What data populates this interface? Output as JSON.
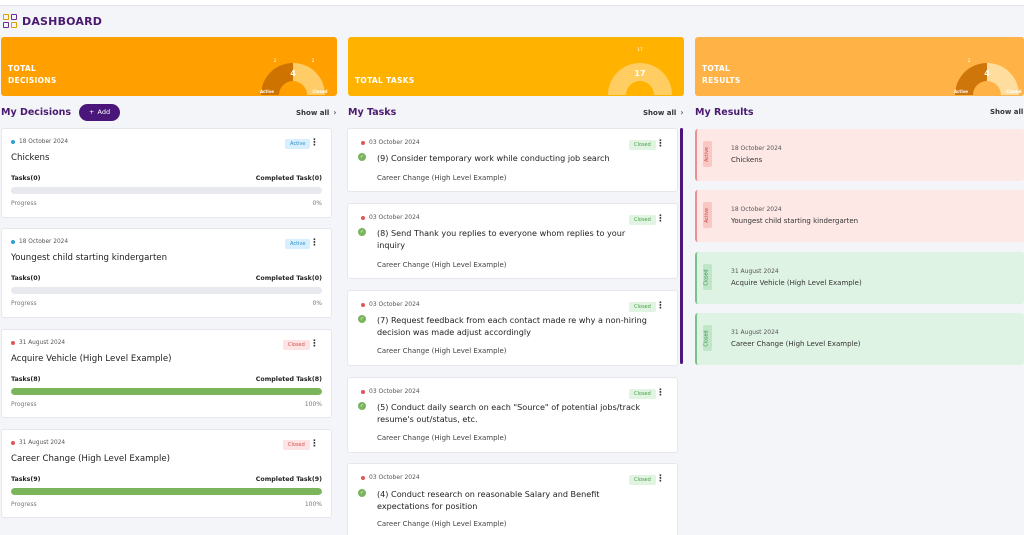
{
  "header": {
    "title": "DASHBOARD"
  },
  "stats": [
    {
      "label_line1": "TOTAL",
      "label_line2": "DECISIONS",
      "total": "4",
      "active": "2",
      "closed": "2",
      "active_label": "Active",
      "closed_label": "Closed",
      "active_fraction": 0.5
    },
    {
      "label_line1": "TOTAL TASKS",
      "label_line2": "",
      "total": "17",
      "active": "",
      "closed": "17",
      "active_label": "",
      "closed_label": "Closed",
      "active_fraction": 0
    },
    {
      "label_line1": "TOTAL",
      "label_line2": "RESULTS",
      "total": "4",
      "active": "2",
      "closed": "",
      "active_label": "Active",
      "closed_label": "Closed",
      "active_fraction": 0.5
    }
  ],
  "decisions": {
    "title": "My Decisions",
    "add_label": "Add",
    "show_all": "Show all",
    "items": [
      {
        "date": "18 October 2024",
        "title": "Chickens",
        "status": "Active",
        "tasks": "Tasks(0)",
        "completed": "Completed Task(0)",
        "progress_label": "Progress",
        "progress": "0%"
      },
      {
        "date": "18 October 2024",
        "title": "Youngest child starting kindergarten",
        "status": "Active",
        "tasks": "Tasks(0)",
        "completed": "Completed Task(0)",
        "progress_label": "Progress",
        "progress": "0%"
      },
      {
        "date": "31 August 2024",
        "title": "Acquire Vehicle (High Level Example)",
        "status": "Closed",
        "tasks": "Tasks(8)",
        "completed": "Completed Task(8)",
        "progress_label": "Progress",
        "progress": "100%"
      },
      {
        "date": "31 August 2024",
        "title": "Career Change (High Level Example)",
        "status": "Closed",
        "tasks": "Tasks(9)",
        "completed": "Completed Task(9)",
        "progress_label": "Progress",
        "progress": "100%"
      }
    ]
  },
  "tasks": {
    "title": "My Tasks",
    "show_all": "Show all",
    "items": [
      {
        "date": "03 October 2024",
        "title": "(9) Consider temporary work while conducting job search",
        "status": "Closed",
        "decision": "Career Change (High Level Example)"
      },
      {
        "date": "03 October 2024",
        "title": "(8) Send Thank you replies to everyone whom replies to your inquiry",
        "status": "Closed",
        "decision": "Career Change (High Level Example)"
      },
      {
        "date": "03 October 2024",
        "title": "(7) Request feedback from each contact made re why a non-hiring decision was made adjust accordingly",
        "status": "Closed",
        "decision": "Career Change (High Level Example)"
      },
      {
        "date": "03 October 2024",
        "title": "(5) Conduct daily search on each \"Source\" of potential jobs/track resume's out/status, etc.",
        "status": "Closed",
        "decision": "Career Change (High Level Example)"
      },
      {
        "date": "03 October 2024",
        "title": "(4) Conduct research on reasonable Salary and Benefit expectations for position",
        "status": "Closed",
        "decision": "Career Change (High Level Example)"
      }
    ]
  },
  "results": {
    "title": "My Results",
    "show_all": "Show all",
    "items": [
      {
        "date": "18 October 2024",
        "title": "Chickens",
        "status": "Active"
      },
      {
        "date": "18 October 2024",
        "title": "Youngest child starting kindergarten",
        "status": "Active"
      },
      {
        "date": "31 August 2024",
        "title": "Acquire Vehicle (High Level Example)",
        "status": "Closed"
      },
      {
        "date": "31 August 2024",
        "title": "Career Change (High Level Example)",
        "status": "Closed"
      }
    ]
  },
  "colors": {
    "brand": "#4b1679",
    "active_dot": "#2f9ed6",
    "closed_dot": "#e05555",
    "progress_fill": "#7ab55c"
  }
}
